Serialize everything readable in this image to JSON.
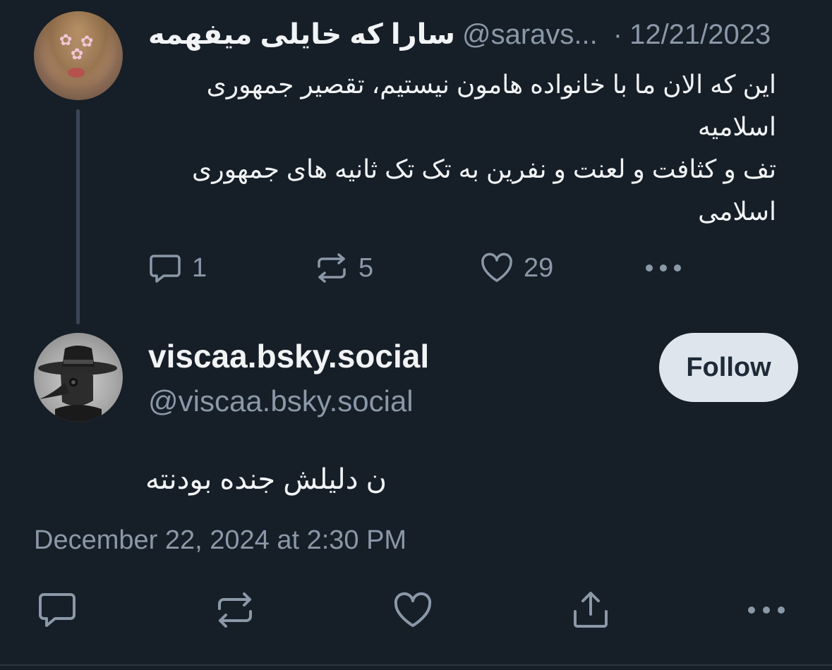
{
  "parent_post": {
    "author_name": "سارا که خایلی میفهمه",
    "author_handle": "@saravs...",
    "separator": "·",
    "date": "12/21/2023",
    "text_lines": [
      "این که الان ما با خانواده هامون نیستیم، تقصیر جمهوری اسلامیه",
      "تف و کثافت و لعنت و نفرین به تک تک ثانیه های جمهوری اسلامی"
    ],
    "actions": {
      "reply_count": "1",
      "repost_count": "5",
      "like_count": "29"
    }
  },
  "reply_post": {
    "author_name": "viscaa.bsky.social",
    "author_handle": "@viscaa.bsky.social",
    "follow_label": "Follow",
    "text": "ن دلیلش جنده بودنته",
    "timestamp": "December 22, 2024 at 2:30 PM"
  },
  "colors": {
    "background": "#161e27",
    "text_primary": "#f1f3f5",
    "text_secondary": "#8a98a8",
    "follow_button_bg": "#dfe5ec",
    "thread_line": "#3a4654"
  },
  "icons": {
    "reply": "reply-icon",
    "repost": "repost-icon",
    "like": "heart-icon",
    "more": "more-icon",
    "share": "share-icon"
  }
}
